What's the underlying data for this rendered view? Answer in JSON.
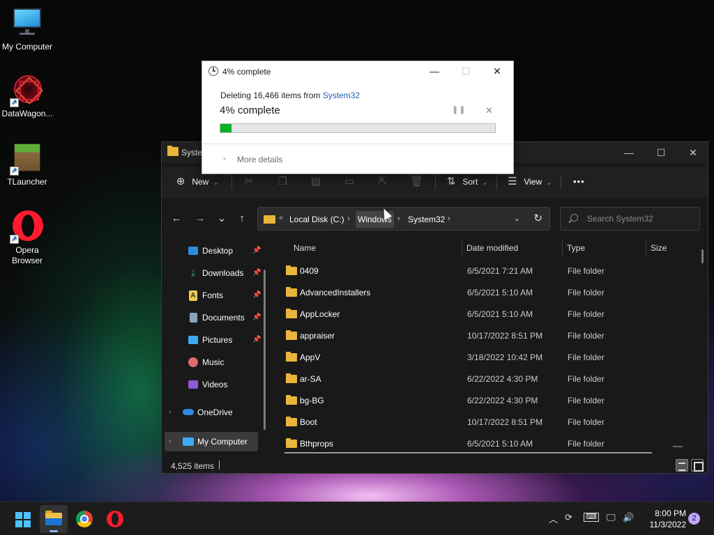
{
  "desktop": {
    "icons": [
      {
        "label": "My Computer",
        "icon": "monitor-icon"
      },
      {
        "label": "DataWagon...",
        "icon": "datawagon-icon"
      },
      {
        "label": "TLauncher",
        "icon": "minecraft-grass-block-icon"
      },
      {
        "label": "Opera Browser",
        "icon": "opera-icon"
      }
    ]
  },
  "explorer": {
    "title": "System32",
    "toolbar": {
      "new_label": "New",
      "sort_label": "Sort",
      "view_label": "View",
      "more_glyph": "•••"
    },
    "nav": {
      "back": "←",
      "forward": "→",
      "recent": "⌄",
      "up": "↑"
    },
    "breadcrumb": [
      "Local Disk (C:)",
      "Windows",
      "System32"
    ],
    "search_placeholder": "Search System32",
    "sidebar": {
      "quick_access": [
        {
          "label": "Desktop",
          "pinned": true
        },
        {
          "label": "Downloads",
          "pinned": true
        },
        {
          "label": "Fonts",
          "pinned": true
        },
        {
          "label": "Documents",
          "pinned": true
        },
        {
          "label": "Pictures",
          "pinned": true
        },
        {
          "label": "Music",
          "pinned": false
        },
        {
          "label": "Videos",
          "pinned": false
        }
      ],
      "onedrive_label": "OneDrive",
      "my_computer_label": "My Computer"
    },
    "columns": {
      "name": "Name",
      "date": "Date modified",
      "type": "Type",
      "size": "Size"
    },
    "files": [
      {
        "name": "0409",
        "date": "6/5/2021 7:21 AM",
        "type": "File folder"
      },
      {
        "name": "AdvancedInstallers",
        "date": "6/5/2021 5:10 AM",
        "type": "File folder"
      },
      {
        "name": "AppLocker",
        "date": "6/5/2021 5:10 AM",
        "type": "File folder"
      },
      {
        "name": "appraiser",
        "date": "10/17/2022 8:51 PM",
        "type": "File folder"
      },
      {
        "name": "AppV",
        "date": "3/18/2022 10:42 PM",
        "type": "File folder"
      },
      {
        "name": "ar-SA",
        "date": "6/22/2022 4:30 PM",
        "type": "File folder"
      },
      {
        "name": "bg-BG",
        "date": "6/22/2022 4:30 PM",
        "type": "File folder"
      },
      {
        "name": "Boot",
        "date": "10/17/2022 8:51 PM",
        "type": "File folder"
      },
      {
        "name": "Bthprops",
        "date": "6/5/2021 5:10 AM",
        "type": "File folder"
      }
    ],
    "status": {
      "item_count": "4,525 items"
    }
  },
  "dialog": {
    "title": "4% complete",
    "message_prefix": "Deleting 16,466 items from ",
    "message_link": "System32",
    "percent_label": "4% complete",
    "progress_percent": 4,
    "more_details": "More details",
    "progress_color": "#06b025"
  },
  "taskbar": {
    "apps": [
      "windows-start-icon",
      "file-explorer-icon",
      "chrome-icon",
      "opera-icon"
    ],
    "time": "8:00 PM",
    "date": "11/3/2022",
    "notifications": "2"
  }
}
